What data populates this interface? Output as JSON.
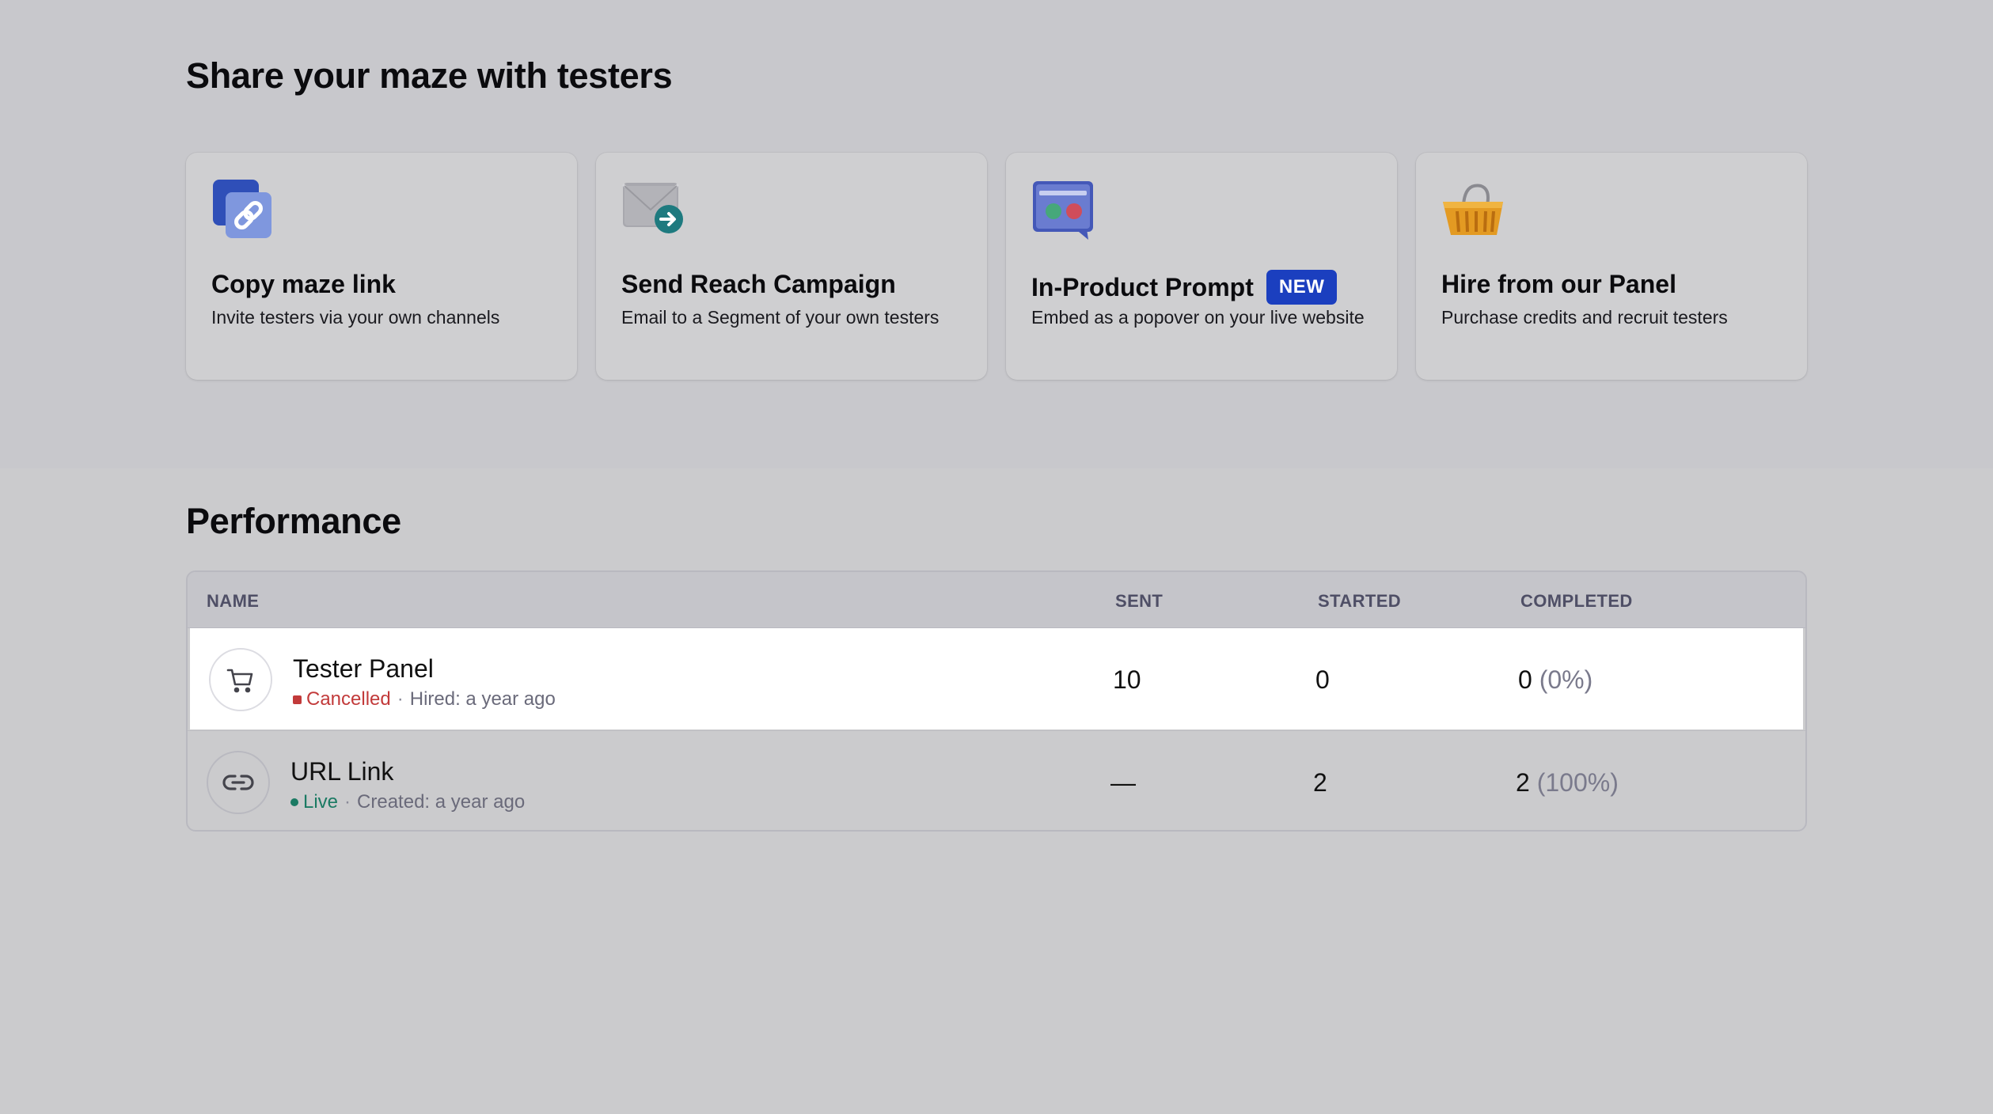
{
  "share": {
    "heading": "Share your maze with testers",
    "cards": [
      {
        "title": "Copy maze link",
        "desc": "Invite testers via your own channels",
        "icon": "link-icon"
      },
      {
        "title": "Send Reach Campaign",
        "desc": "Email to a Segment of your own testers",
        "icon": "mail-arrow-icon"
      },
      {
        "title": "In-Product Prompt",
        "badge": "NEW",
        "desc": "Embed as a popover on your live website",
        "icon": "prompt-window-icon"
      },
      {
        "title": "Hire from our Panel",
        "desc": "Purchase credits and recruit testers",
        "icon": "shopping-basket-icon"
      }
    ]
  },
  "performance": {
    "heading": "Performance",
    "columns": {
      "name": "NAME",
      "sent": "SENT",
      "started": "STARTED",
      "completed": "COMPLETED"
    },
    "rows": [
      {
        "name": "Tester Panel",
        "status": "Cancelled",
        "meta": "Hired: a year ago",
        "sent": "10",
        "started": "0",
        "completed": "0",
        "completed_pct": "(0%)",
        "icon": "cart-icon",
        "status_color": "#c23a3a"
      },
      {
        "name": "URL Link",
        "status": "Live",
        "meta": "Created: a year ago",
        "sent": "—",
        "started": "2",
        "completed": "2",
        "completed_pct": "(100%)",
        "icon": "link-icon",
        "status_color": "#1b7a63"
      }
    ]
  }
}
